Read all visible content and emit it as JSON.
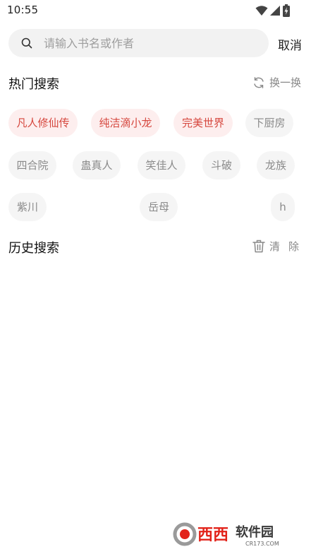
{
  "status_bar": {
    "time": "10:55",
    "icons": [
      "wifi-icon",
      "cell-signal-icon",
      "battery-charging-icon"
    ]
  },
  "search": {
    "placeholder": "请输入书名或作者",
    "value": "",
    "cancel_label": "取消"
  },
  "hot_search": {
    "title": "热门搜索",
    "refresh_label": "换一换",
    "tags": [
      {
        "label": "凡人修仙传",
        "highlight": true
      },
      {
        "label": "纯洁滴小龙",
        "highlight": true
      },
      {
        "label": "完美世界",
        "highlight": true
      },
      {
        "label": "下厨房",
        "highlight": false
      },
      {
        "label": "四合院",
        "highlight": false
      },
      {
        "label": "蛊真人",
        "highlight": false
      },
      {
        "label": "笑佳人",
        "highlight": false
      },
      {
        "label": "斗破",
        "highlight": false
      },
      {
        "label": "龙族",
        "highlight": false
      },
      {
        "label": "紫川",
        "highlight": false
      },
      {
        "label": "岳母",
        "highlight": false
      },
      {
        "label": "h",
        "highlight": false
      }
    ]
  },
  "history_search": {
    "title": "历史搜索",
    "clear_label": "清除"
  },
  "colors": {
    "hot_tag_bg": "#fdeeee",
    "hot_tag_text": "#d6473e",
    "tag_bg": "#f5f5f5",
    "tag_text": "#8a8a8a",
    "watermark_brand": "#e2231a"
  },
  "watermark": {
    "brand": "西西",
    "site_name": "软件园",
    "domain": "CR173.COM"
  }
}
